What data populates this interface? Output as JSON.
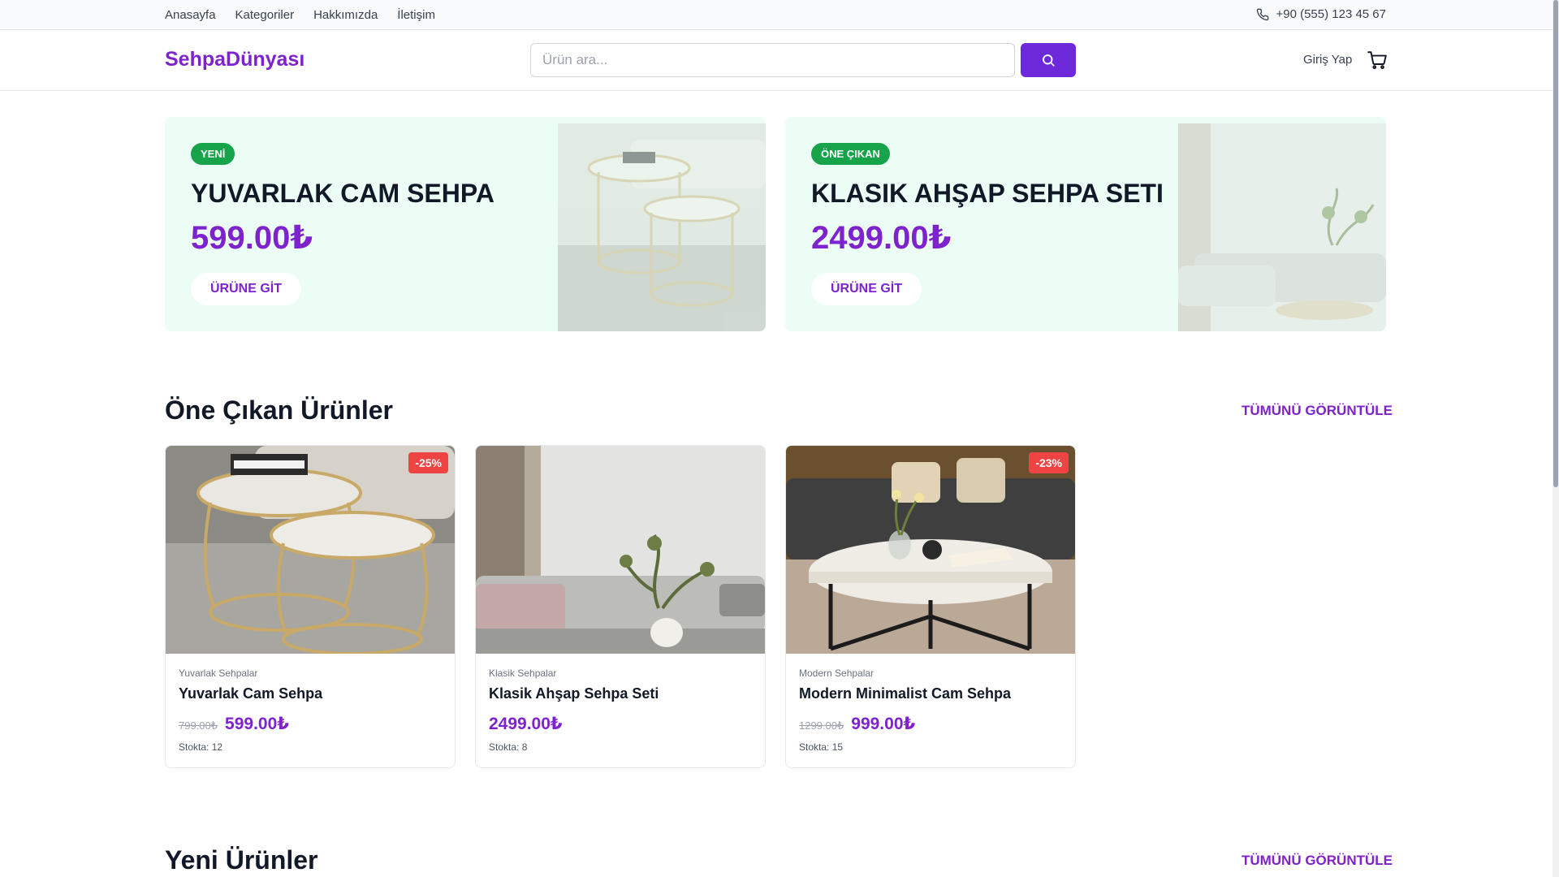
{
  "topbar": {
    "nav": [
      "Anasayfa",
      "Kategoriler",
      "Hakkımızda",
      "İletişim"
    ],
    "phone": "+90 (555) 123 45 67"
  },
  "header": {
    "logo": "SehpaDünyası",
    "search_placeholder": "Ürün ara...",
    "login": "Giriş Yap"
  },
  "banners": [
    {
      "badge": "YENİ",
      "title": "YUVARLAK CAM SEHPA",
      "price": "599.00₺",
      "button": "ÜRÜNE GİT"
    },
    {
      "badge": "ÖNE ÇIKAN",
      "title": "KLASIK AHŞAP SEHPA SETI",
      "price": "2499.00₺",
      "button": "ÜRÜNE GİT"
    }
  ],
  "featured": {
    "title": "Öne Çıkan Ürünler",
    "view_all": "TÜMÜNÜ GÖRÜNTÜLE",
    "products": [
      {
        "discount": "-25%",
        "category": "Yuvarlak Sehpalar",
        "name": "Yuvarlak Cam Sehpa",
        "old_price": "799.00₺",
        "price": "599.00₺",
        "stock": "Stokta: 12"
      },
      {
        "discount": "",
        "category": "Klasik Sehpalar",
        "name": "Klasik Ahşap Sehpa Seti",
        "old_price": "",
        "price": "2499.00₺",
        "stock": "Stokta: 8"
      },
      {
        "discount": "-23%",
        "category": "Modern Sehpalar",
        "name": "Modern Minimalist Cam Sehpa",
        "old_price": "1299.00₺",
        "price": "999.00₺",
        "stock": "Stokta: 15"
      }
    ]
  },
  "new_products": {
    "title": "Yeni Ürünler",
    "view_all": "TÜMÜNÜ GÖRÜNTÜLE"
  },
  "colors": {
    "accent": "#7e22ce",
    "button": "#6d28d9",
    "badge_green": "#16a34a",
    "discount_red": "#ef4444",
    "banner_bg": "#ecfdf5"
  },
  "icons": [
    "phone-icon",
    "search-icon",
    "cart-icon"
  ]
}
